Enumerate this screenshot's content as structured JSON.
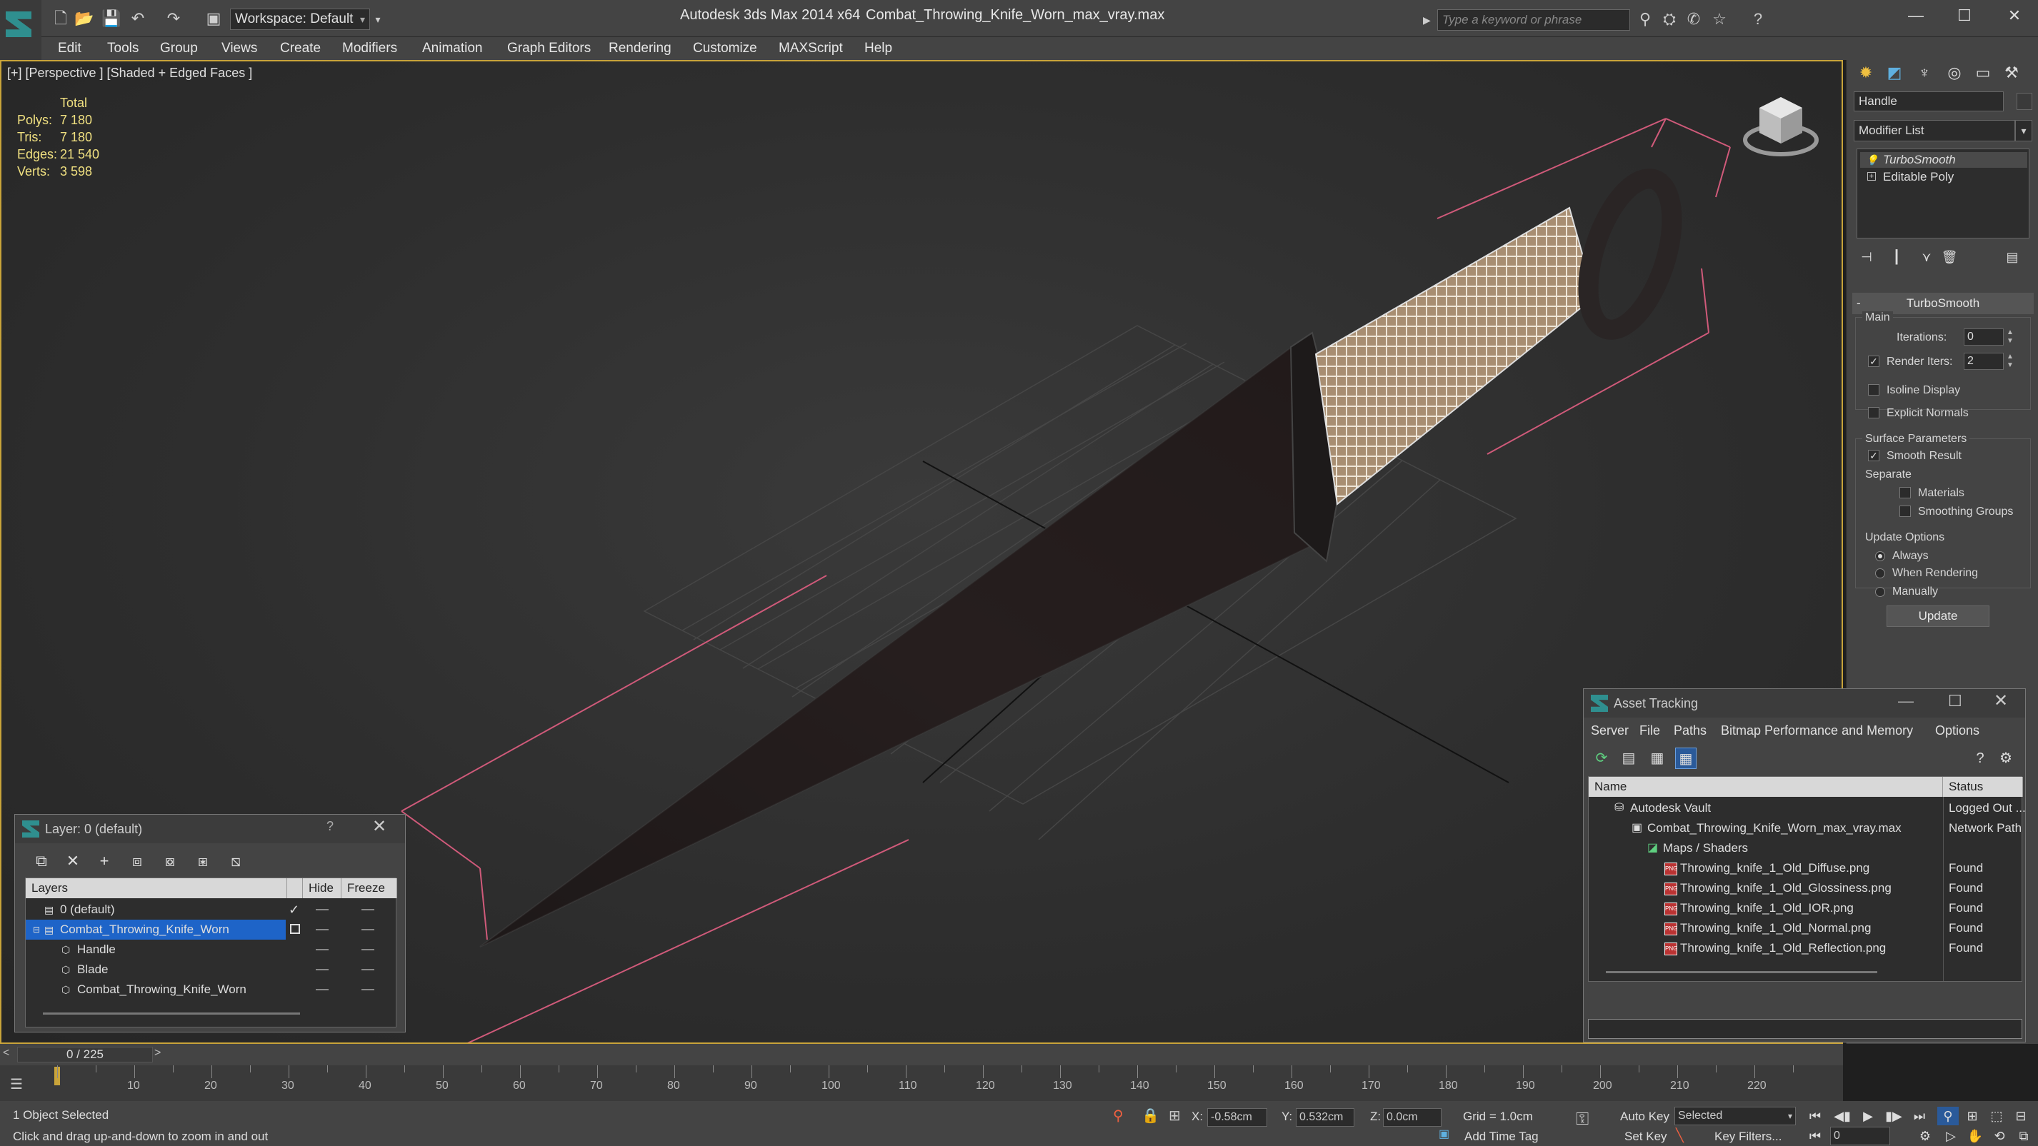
{
  "window": {
    "workspace": "Workspace: Default",
    "app_title": "Autodesk 3ds Max  2014 x64",
    "doc_title": "Combat_Throwing_Knife_Worn_max_vray.max",
    "search_placeholder": "Type a keyword or phrase"
  },
  "menu": [
    "Edit",
    "Tools",
    "Group",
    "Views",
    "Create",
    "Modifiers",
    "Animation",
    "Graph Editors",
    "Rendering",
    "Customize",
    "MAXScript",
    "Help"
  ],
  "viewport": {
    "label": "[+] [Perspective ] [Shaded + Edged Faces ]",
    "stats_header": "Total",
    "stats": [
      {
        "k": "Polys:",
        "v": "7 180"
      },
      {
        "k": "Tris:",
        "v": "7 180"
      },
      {
        "k": "Edges:",
        "v": "21 540"
      },
      {
        "k": "Verts:",
        "v": "3 598"
      }
    ]
  },
  "command_panel": {
    "object_name": "Handle",
    "modifier_list": "Modifier List",
    "stack": [
      "TurboSmooth",
      "Editable Poly"
    ],
    "rollout_title": "TurboSmooth",
    "main_label": "Main",
    "iterations_label": "Iterations:",
    "iterations_value": "0",
    "render_iters_label": "Render Iters:",
    "render_iters_value": "2",
    "isoline_label": "Isoline Display",
    "explicit_normals_label": "Explicit Normals",
    "surface_params_label": "Surface Parameters",
    "smooth_result_label": "Smooth Result",
    "separate_label": "Separate",
    "materials_label": "Materials",
    "smoothing_groups_label": "Smoothing Groups",
    "update_options_label": "Update Options",
    "always_label": "Always",
    "when_rendering_label": "When Rendering",
    "manually_label": "Manually",
    "update_button": "Update"
  },
  "layer_dialog": {
    "title": "Layer: 0 (default)",
    "help": "?",
    "col_layers": "Layers",
    "col_hide": "Hide",
    "col_freeze": "Freeze",
    "rows": [
      "0 (default)",
      "Combat_Throwing_Knife_Worn",
      "Handle",
      "Blade",
      "Combat_Throwing_Knife_Worn"
    ]
  },
  "asset_dialog": {
    "title": "Asset Tracking",
    "menu": [
      "Server",
      "File",
      "Paths",
      "Bitmap Performance and Memory",
      "Options"
    ],
    "col_name": "Name",
    "col_status": "Status",
    "rows": [
      {
        "name": "Autodesk Vault",
        "status": "Logged Out ..."
      },
      {
        "name": "Combat_Throwing_Knife_Worn_max_vray.max",
        "status": "Network Path"
      },
      {
        "name": "Maps / Shaders",
        "status": ""
      },
      {
        "name": "Throwing_knife_1_Old_Diffuse.png",
        "status": "Found"
      },
      {
        "name": "Throwing_knife_1_Old_Glossiness.png",
        "status": "Found"
      },
      {
        "name": "Throwing_knife_1_Old_IOR.png",
        "status": "Found"
      },
      {
        "name": "Throwing_knife_1_Old_Normal.png",
        "status": "Found"
      },
      {
        "name": "Throwing_knife_1_Old_Reflection.png",
        "status": "Found"
      }
    ]
  },
  "timeline": {
    "frame": "0 / 225",
    "ticks": [
      "10",
      "20",
      "30",
      "40",
      "50",
      "60",
      "70",
      "80",
      "90",
      "100",
      "110",
      "120",
      "130",
      "140",
      "150",
      "160",
      "170",
      "180",
      "190",
      "200",
      "210",
      "220"
    ]
  },
  "status": {
    "selection": "1 Object Selected",
    "prompt": "Click and drag up-and-down to zoom in and out",
    "x_label": "X:",
    "x_value": "-0.58cm",
    "y_label": "Y:",
    "y_value": "0.532cm",
    "z_label": "Z:",
    "z_value": "0.0cm",
    "grid": "Grid = 1.0cm",
    "auto_key": "Auto Key",
    "set_key": "Set Key",
    "key_mode": "Selected",
    "key_filters": "Key Filters...",
    "add_time_tag": "Add Time Tag",
    "current_frame": "0"
  },
  "colors": {
    "accent": "#c9a43a",
    "selection": "#1e64c8",
    "logo": "#2f8f8f"
  }
}
